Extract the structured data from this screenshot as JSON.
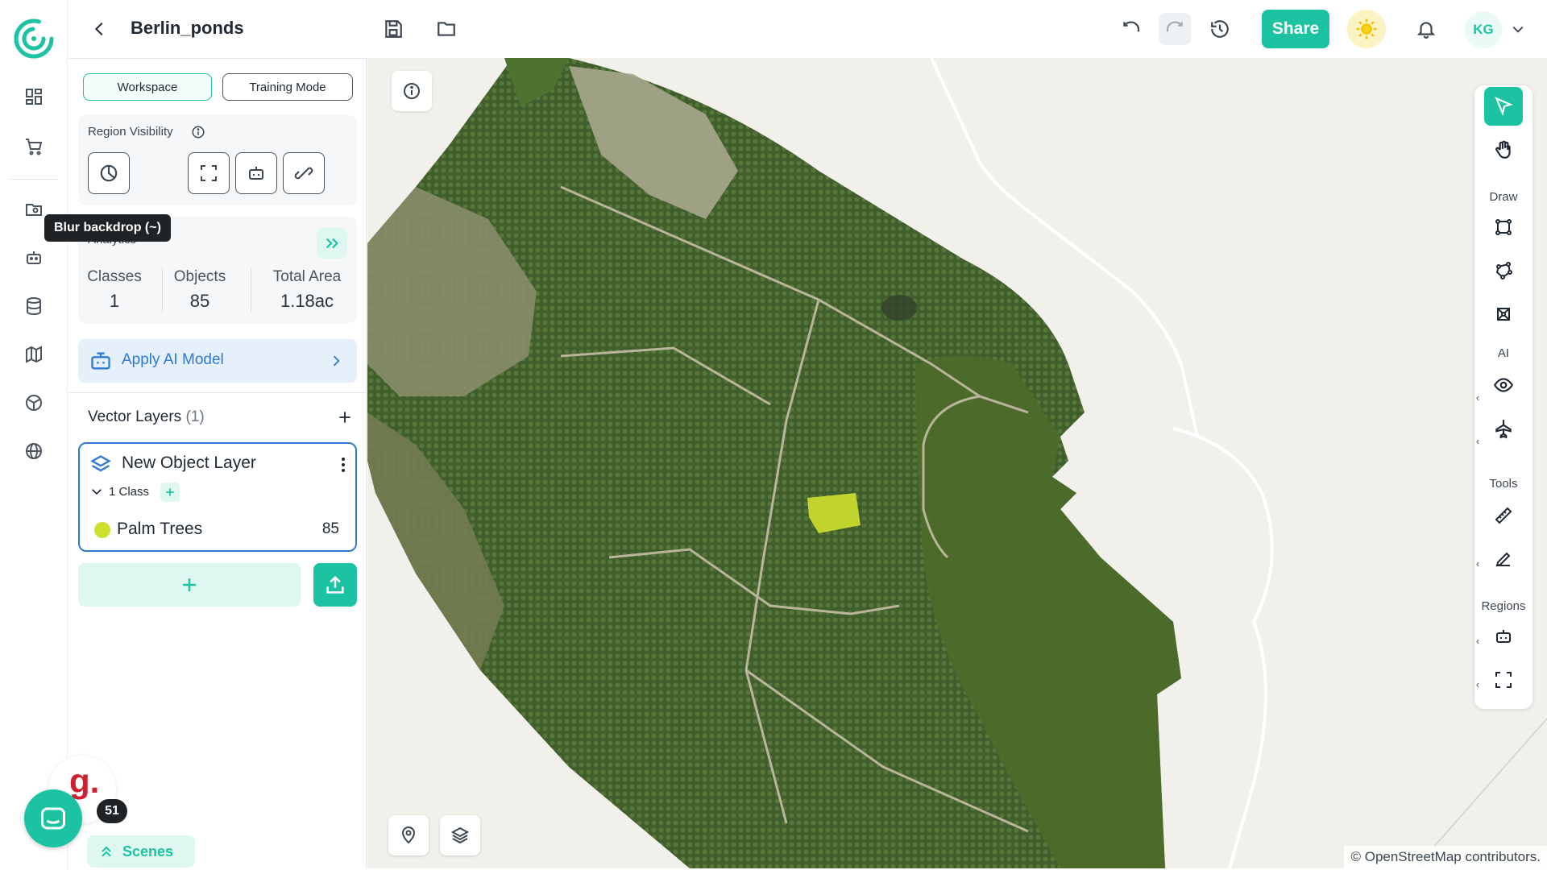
{
  "app": {
    "project_title": "Berlin_ponds"
  },
  "topbar": {
    "share_label": "Share",
    "user_initials": "KG"
  },
  "panel": {
    "modes": [
      "Workspace",
      "Training Mode"
    ],
    "region_visibility": {
      "label": "Region Visibility",
      "tooltip": "Blur backdrop (~)"
    },
    "analytics": {
      "title": "Analytics",
      "stats": [
        {
          "label": "Classes",
          "value": "1"
        },
        {
          "label": "Objects",
          "value": "85"
        },
        {
          "label": "Total Area",
          "value": "1.18ac"
        }
      ]
    },
    "apply_ai_label": "Apply AI Model",
    "vector_layers": {
      "title": "Vector Layers",
      "count": "(1)",
      "layer": {
        "name": "New Object Layer",
        "class_count_label": "1 Class",
        "classes": [
          {
            "name": "Palm Trees",
            "count": "85",
            "color": "#cfe02e"
          }
        ]
      }
    },
    "scenes_label": "Scenes"
  },
  "right_toolbar": {
    "sections": {
      "draw": "Draw",
      "ai": "AI",
      "tools": "Tools",
      "regions": "Regions"
    },
    "chevron": "‹"
  },
  "map": {
    "attribution": "© OpenStreetMap contributors."
  },
  "chat": {
    "badge_count": "51",
    "widget_letter": "g."
  },
  "colors": {
    "accent": "#1bc3a3",
    "ai_blue": "#2e7ad1",
    "class_yellow": "#cfe02e"
  },
  "icons": [
    "logo-icon",
    "dashboard-icon",
    "cart-icon",
    "folder-icon",
    "robot-icon",
    "database-icon",
    "map-icon",
    "globe-grid-icon",
    "globe-icon",
    "back-icon",
    "save-icon",
    "open-folder-icon",
    "undo-icon",
    "redo-icon",
    "history-icon",
    "sun-icon",
    "bell-icon",
    "chevron-down-icon",
    "info-icon",
    "blur-icon",
    "fullscreen-icon",
    "robot-icon",
    "link-icon",
    "double-chevron-icon",
    "layers-icon",
    "more-icon",
    "plus-icon",
    "upload-icon",
    "location-pin-icon",
    "cursor-icon",
    "hand-icon",
    "polygon-icon",
    "eye-icon",
    "plane-icon",
    "ruler-icon",
    "pencil-icon",
    "chat-icon"
  ]
}
